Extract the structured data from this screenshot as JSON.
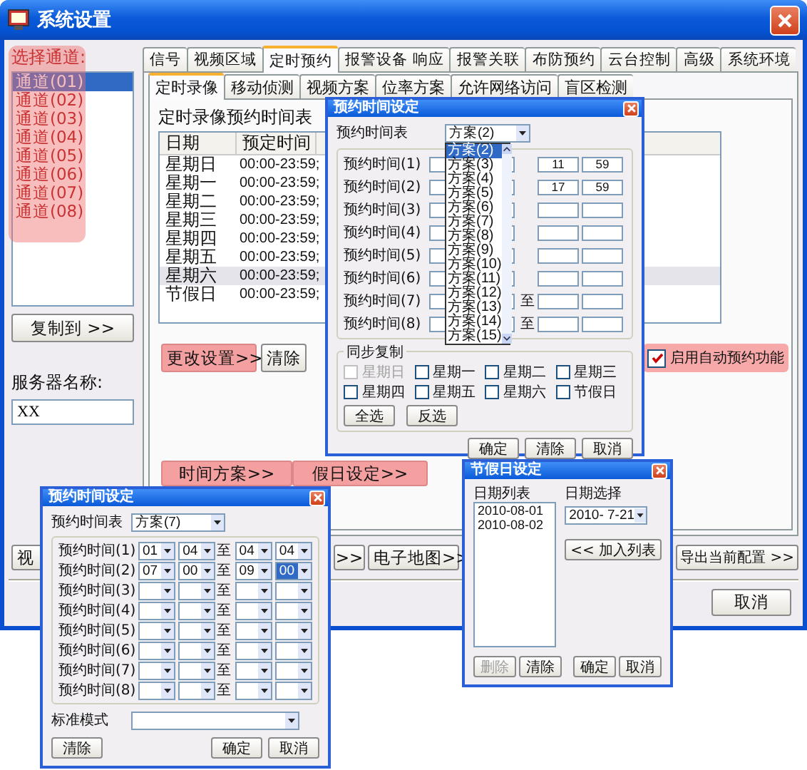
{
  "window": {
    "title": "系统设置"
  },
  "channel_panel": {
    "label": "选择通道:",
    "highlighted": true,
    "channels": [
      {
        "name": "通道(01)",
        "selected": true
      },
      {
        "name": "通道(02)",
        "selected": false
      },
      {
        "name": "通道(03)",
        "selected": false
      },
      {
        "name": "通道(04)",
        "selected": false
      },
      {
        "name": "通道(05)",
        "selected": false
      },
      {
        "name": "通道(06)",
        "selected": false
      },
      {
        "name": "通道(07)",
        "selected": false
      },
      {
        "name": "通道(08)",
        "selected": false
      }
    ],
    "copy_button": "复制到 >>",
    "server_label": "服务器名称:",
    "server_name": "XX"
  },
  "tabs": [
    {
      "label": "信号",
      "selected": false
    },
    {
      "label": "视频区域",
      "selected": false
    },
    {
      "label": "定时预约",
      "selected": true
    },
    {
      "label": "报警设备 响应",
      "selected": false
    },
    {
      "label": "报警关联",
      "selected": false
    },
    {
      "label": "布防预约",
      "selected": false
    },
    {
      "label": "云台控制",
      "selected": false
    },
    {
      "label": "高级",
      "selected": false
    },
    {
      "label": "系统环境",
      "selected": false
    }
  ],
  "subtabs": [
    {
      "label": "定时录像",
      "selected": true
    },
    {
      "label": "移动侦测",
      "selected": false
    },
    {
      "label": "视频方案",
      "selected": false
    },
    {
      "label": "位率方案",
      "selected": false
    },
    {
      "label": "允许网络访问",
      "selected": false
    },
    {
      "label": "盲区检测",
      "selected": false
    }
  ],
  "schedule": {
    "title": "定时录像预约时间表",
    "columns": [
      "日期",
      "预定时间"
    ],
    "rows": [
      {
        "day": "星期日",
        "time": "00:00-23:59;",
        "selected": false
      },
      {
        "day": "星期一",
        "time": "00:00-23:59;",
        "selected": false
      },
      {
        "day": "星期二",
        "time": "00:00-23:59;",
        "selected": false
      },
      {
        "day": "星期三",
        "time": "00:00-23:59;",
        "selected": false
      },
      {
        "day": "星期四",
        "time": "00:00-23:59;",
        "selected": false
      },
      {
        "day": "星期五",
        "time": "00:00-23:59;",
        "selected": false
      },
      {
        "day": "星期六",
        "time": "00:00-23:59;",
        "selected": true
      },
      {
        "day": "节假日",
        "time": "00:00-23:59;",
        "selected": false
      }
    ]
  },
  "action_buttons": [
    {
      "label": "更改设置>>",
      "highlighted": true
    },
    {
      "label": "清除",
      "highlighted": false
    }
  ],
  "auto_schedule": {
    "label": "启用自动预约功能",
    "checked": true,
    "highlighted": true
  },
  "plan_buttons": [
    {
      "label": "时间方案>>",
      "highlighted": true
    },
    {
      "label": "假日设定>>",
      "highlighted": true
    }
  ],
  "bottom_buttons": [
    {
      "label": "视"
    },
    {
      "label": ">>"
    },
    {
      "label": "电子地图>>"
    },
    {
      "label": "导出当前配置 >>"
    }
  ],
  "footer_buttons": [
    {
      "label": "取消"
    }
  ],
  "time_dialog_open": {
    "title": "预约时间设定",
    "plan_label": "预约时间表",
    "plan_value": "方案(2)",
    "options": [
      {
        "label": "方案(2)",
        "selected": true
      },
      {
        "label": "方案(3)",
        "selected": false
      },
      {
        "label": "方案(4)",
        "selected": false
      },
      {
        "label": "方案(5)",
        "selected": false
      },
      {
        "label": "方案(6)",
        "selected": false
      },
      {
        "label": "方案(7)",
        "selected": false
      },
      {
        "label": "方案(8)",
        "selected": false
      },
      {
        "label": "方案(9)",
        "selected": false
      },
      {
        "label": "方案(10)",
        "selected": false
      },
      {
        "label": "方案(11)",
        "selected": false
      },
      {
        "label": "方案(12)",
        "selected": false
      },
      {
        "label": "方案(13)",
        "selected": false
      },
      {
        "label": "方案(14)",
        "selected": false
      },
      {
        "label": "方案(15)",
        "selected": false
      }
    ],
    "rows": [
      {
        "label": "预约时间(1)",
        "end_hour": "11",
        "end_minute": "59"
      },
      {
        "label": "预约时间(2)",
        "end_hour": "17",
        "end_minute": "59"
      },
      {
        "label": "预约时间(3)"
      },
      {
        "label": "预约时间(4)"
      },
      {
        "label": "预约时间(5)"
      },
      {
        "label": "预约时间(6)"
      },
      {
        "label": "预约时间(7)",
        "to": "至"
      },
      {
        "label": "预约时间(8)",
        "to": "至"
      }
    ],
    "sync": {
      "title": "同步复制",
      "days": [
        {
          "label": "星期日",
          "checked": false,
          "disabled": true
        },
        {
          "label": "星期一",
          "checked": false,
          "disabled": false
        },
        {
          "label": "星期二",
          "checked": false,
          "disabled": false
        },
        {
          "label": "星期三",
          "checked": false,
          "disabled": false
        },
        {
          "label": "星期四",
          "checked": false,
          "disabled": false
        },
        {
          "label": "星期五",
          "checked": false,
          "disabled": false
        },
        {
          "label": "星期六",
          "checked": false,
          "disabled": false
        },
        {
          "label": "节假日",
          "checked": false,
          "disabled": false
        }
      ],
      "buttons": [
        "全选",
        "反选"
      ]
    },
    "buttons": [
      "确定",
      "清除",
      "取消"
    ]
  },
  "time_dialog": {
    "title": "预约时间设定",
    "plan_label": "预约时间表",
    "plan_value": "方案(7)",
    "rows": [
      {
        "label": "预约时间(1)",
        "start_hour": "01",
        "start_minute": "04",
        "to": "至",
        "end_hour": "04",
        "end_minute": "04",
        "focused": false
      },
      {
        "label": "预约时间(2)",
        "start_hour": "07",
        "start_minute": "00",
        "to": "至",
        "end_hour": "09",
        "end_minute": "00",
        "focused": true
      },
      {
        "label": "预约时间(3)",
        "to": "至",
        "focused": false
      },
      {
        "label": "预约时间(4)",
        "to": "至",
        "focused": false
      },
      {
        "label": "预约时间(5)",
        "to": "至",
        "focused": false
      },
      {
        "label": "预约时间(6)",
        "to": "至",
        "focused": false
      },
      {
        "label": "预约时间(7)",
        "to": "至",
        "focused": false
      },
      {
        "label": "预约时间(8)",
        "to": "至",
        "focused": false
      }
    ],
    "mode_label": "标准模式",
    "buttons": [
      "清除",
      "确定",
      "取消"
    ]
  },
  "holiday_dialog": {
    "title": "节假日设定",
    "list_label": "日期列表",
    "dates": [
      "2010-08-01",
      "2010-08-02"
    ],
    "picker_label": "日期选择",
    "picker_value": "2010- 7-21",
    "add_button": "<< 加入列表",
    "buttons": [
      {
        "label": "删除",
        "disabled": true
      },
      {
        "label": "清除",
        "disabled": false
      },
      {
        "label": "确定",
        "disabled": false
      },
      {
        "label": "取消",
        "disabled": false
      }
    ]
  }
}
